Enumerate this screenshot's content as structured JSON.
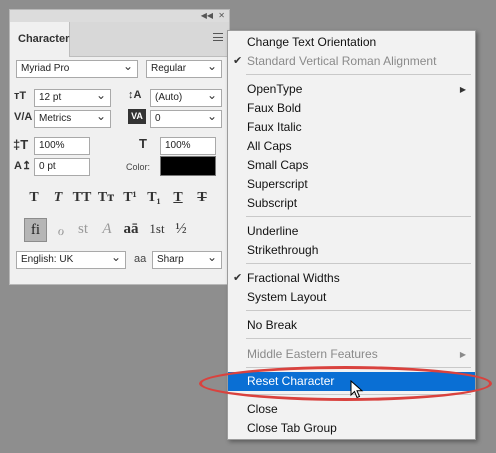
{
  "panel": {
    "tab_label": "Character",
    "font_family": "Myriad Pro",
    "font_style": "Regular",
    "font_size": "12 pt",
    "leading": "(Auto)",
    "kerning": "Metrics",
    "tracking": "0",
    "vertical_scale": "100%",
    "horizontal_scale": "100%",
    "baseline_shift": "0 pt",
    "color_label": "Color:",
    "color_value": "#000000",
    "language": "English: UK",
    "antialias_label": "aa",
    "antialias": "Sharp",
    "style_buttons": [
      "T",
      "T",
      "TT",
      "Tт",
      "T¹",
      "T₁",
      "T",
      "T"
    ],
    "opentype_buttons": [
      "fi",
      "ℴ",
      "st",
      "A",
      "aā",
      "1st",
      "½"
    ]
  },
  "menu": {
    "items": [
      {
        "label": "Change Text Orientation",
        "disabled": false
      },
      {
        "label": "Standard Vertical Roman Alignment",
        "disabled": true,
        "checked": true
      },
      {
        "label": "OpenType",
        "submenu": true
      },
      {
        "label": "Faux Bold"
      },
      {
        "label": "Faux Italic"
      },
      {
        "label": "All Caps"
      },
      {
        "label": "Small Caps"
      },
      {
        "label": "Superscript"
      },
      {
        "label": "Subscript"
      },
      {
        "label": "Underline"
      },
      {
        "label": "Strikethrough"
      },
      {
        "label": "Fractional Widths",
        "checked": true
      },
      {
        "label": "System Layout"
      },
      {
        "label": "No Break"
      },
      {
        "label": "Middle Eastern Features",
        "disabled": true,
        "submenu": true
      },
      {
        "label": "Reset Character",
        "highlighted": true
      },
      {
        "label": "Close"
      },
      {
        "label": "Close Tab Group"
      }
    ]
  },
  "icons": {
    "collapse": "double-chevron-icon",
    "close": "close-icon",
    "panel_menu": "hamburger-menu-icon",
    "check": "checkmark-icon",
    "submenu": "submenu-arrow-icon",
    "cursor": "mouse-pointer-icon"
  },
  "colors": {
    "highlight": "#0a6fd4",
    "annotation": "#d9423e"
  }
}
